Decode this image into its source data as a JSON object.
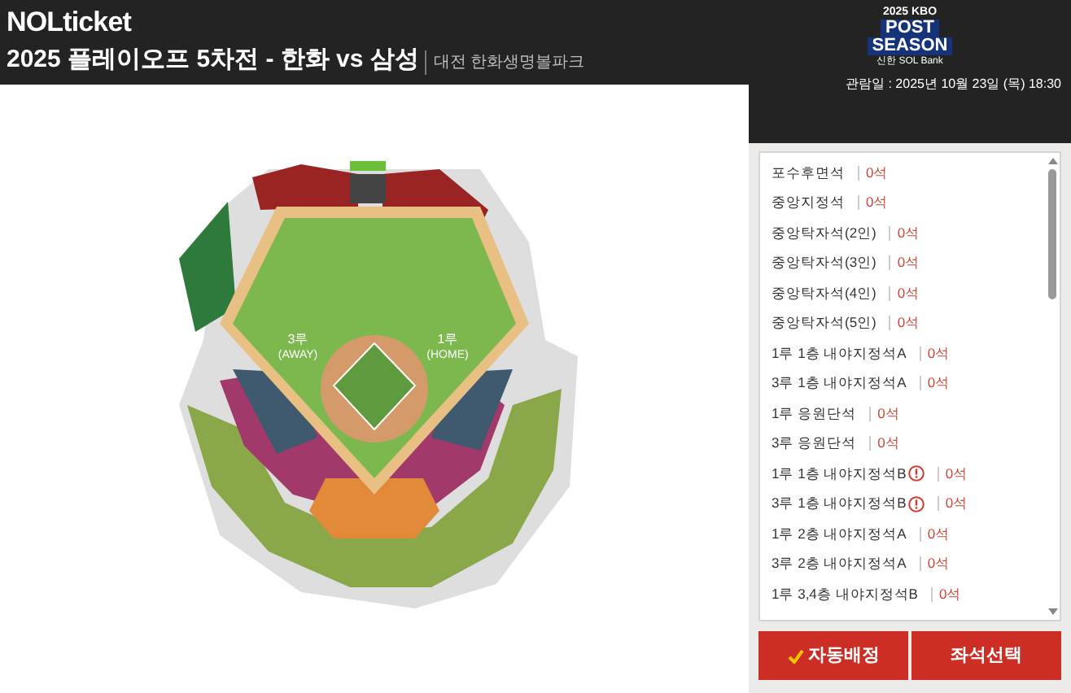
{
  "header": {
    "logo": "NOLticket",
    "title": "2025 플레이오프 5차전 - 한화 vs 삼성",
    "venue": "대전 한화생명볼파크"
  },
  "badge": {
    "year": "2025",
    "league": "KBO",
    "line1": "POST",
    "line2": "SEASON",
    "sponsor": "신한 SOL Bank"
  },
  "date": "관람일 : 2025년 10월 23일 (목) 18:30",
  "map": {
    "labels": [
      "3루",
      "(AWAY)",
      "1루",
      "(HOME)"
    ]
  },
  "seats": [
    {
      "name": "포수후면석",
      "count": "0석",
      "warning": false
    },
    {
      "name": "중앙지정석",
      "count": "0석",
      "warning": false
    },
    {
      "name": "중앙탁자석(2인)",
      "count": "0석",
      "warning": false
    },
    {
      "name": "중앙탁자석(3인)",
      "count": "0석",
      "warning": false
    },
    {
      "name": "중앙탁자석(4인)",
      "count": "0석",
      "warning": false
    },
    {
      "name": "중앙탁자석(5인)",
      "count": "0석",
      "warning": false
    },
    {
      "name": "1루 1층 내야지정석A",
      "count": "0석",
      "warning": false
    },
    {
      "name": "3루 1층 내야지정석A",
      "count": "0석",
      "warning": false
    },
    {
      "name": "1루 응원단석",
      "count": "0석",
      "warning": false
    },
    {
      "name": "3루 응원단석",
      "count": "0석",
      "warning": false
    },
    {
      "name": "1루 1층 내야지정석B",
      "count": "0석",
      "warning": true
    },
    {
      "name": "3루 1층 내야지정석B",
      "count": "0석",
      "warning": true
    },
    {
      "name": "1루 2층 내야지정석A",
      "count": "0석",
      "warning": false
    },
    {
      "name": "3루 2층 내야지정석A",
      "count": "0석",
      "warning": false
    },
    {
      "name": "1루 3,4층 내야지정석B",
      "count": "0석",
      "warning": false
    }
  ],
  "buttons": [
    {
      "label": "자동배정",
      "kind": "auto"
    },
    {
      "label": "좌석선택",
      "kind": "select"
    }
  ]
}
